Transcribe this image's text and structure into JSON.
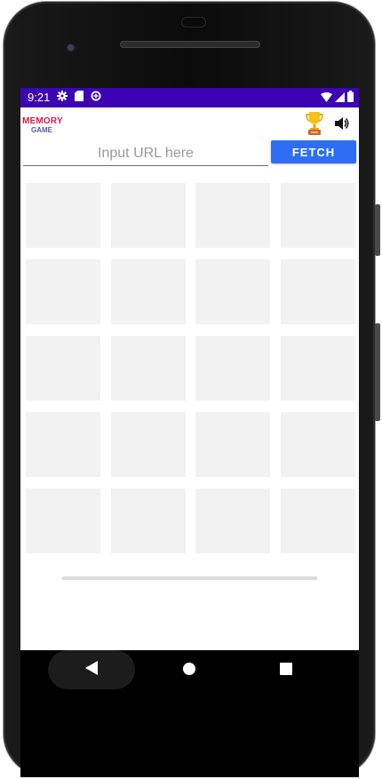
{
  "status_bar": {
    "time": "9:21",
    "left_icons": [
      "gear-icon",
      "sd-card-icon",
      "data-saver-icon"
    ],
    "right_icons": [
      "wifi-icon",
      "cell-signal-icon",
      "battery-icon"
    ],
    "background_color": "#3c03b5"
  },
  "app": {
    "logo": {
      "line1": "MEMORY",
      "line2": "GAME"
    },
    "header_icons": [
      "trophy-icon",
      "volume-icon"
    ],
    "url_input": {
      "value": "",
      "placeholder": "Input URL here"
    },
    "fetch_button": {
      "label": "FETCH",
      "color": "#2f6ef2"
    },
    "grid": {
      "rows": 5,
      "columns": 4,
      "tile_color": "#f2f2f2"
    },
    "progress": {
      "fraction": 0
    }
  },
  "navigation": {
    "buttons": [
      "back-icon",
      "home-icon",
      "recents-icon"
    ]
  }
}
